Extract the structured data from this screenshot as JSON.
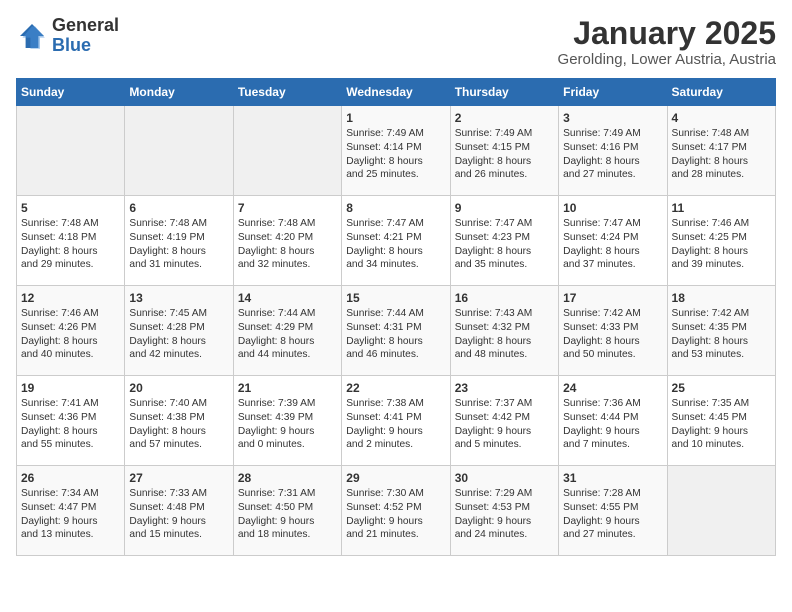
{
  "logo": {
    "general": "General",
    "blue": "Blue"
  },
  "title": "January 2025",
  "subtitle": "Gerolding, Lower Austria, Austria",
  "weekdays": [
    "Sunday",
    "Monday",
    "Tuesday",
    "Wednesday",
    "Thursday",
    "Friday",
    "Saturday"
  ],
  "weeks": [
    [
      {
        "empty": true
      },
      {
        "empty": true
      },
      {
        "empty": true
      },
      {
        "day": "1",
        "lines": [
          "Sunrise: 7:49 AM",
          "Sunset: 4:14 PM",
          "Daylight: 8 hours",
          "and 25 minutes."
        ]
      },
      {
        "day": "2",
        "lines": [
          "Sunrise: 7:49 AM",
          "Sunset: 4:15 PM",
          "Daylight: 8 hours",
          "and 26 minutes."
        ]
      },
      {
        "day": "3",
        "lines": [
          "Sunrise: 7:49 AM",
          "Sunset: 4:16 PM",
          "Daylight: 8 hours",
          "and 27 minutes."
        ]
      },
      {
        "day": "4",
        "lines": [
          "Sunrise: 7:48 AM",
          "Sunset: 4:17 PM",
          "Daylight: 8 hours",
          "and 28 minutes."
        ]
      }
    ],
    [
      {
        "day": "5",
        "lines": [
          "Sunrise: 7:48 AM",
          "Sunset: 4:18 PM",
          "Daylight: 8 hours",
          "and 29 minutes."
        ]
      },
      {
        "day": "6",
        "lines": [
          "Sunrise: 7:48 AM",
          "Sunset: 4:19 PM",
          "Daylight: 8 hours",
          "and 31 minutes."
        ]
      },
      {
        "day": "7",
        "lines": [
          "Sunrise: 7:48 AM",
          "Sunset: 4:20 PM",
          "Daylight: 8 hours",
          "and 32 minutes."
        ]
      },
      {
        "day": "8",
        "lines": [
          "Sunrise: 7:47 AM",
          "Sunset: 4:21 PM",
          "Daylight: 8 hours",
          "and 34 minutes."
        ]
      },
      {
        "day": "9",
        "lines": [
          "Sunrise: 7:47 AM",
          "Sunset: 4:23 PM",
          "Daylight: 8 hours",
          "and 35 minutes."
        ]
      },
      {
        "day": "10",
        "lines": [
          "Sunrise: 7:47 AM",
          "Sunset: 4:24 PM",
          "Daylight: 8 hours",
          "and 37 minutes."
        ]
      },
      {
        "day": "11",
        "lines": [
          "Sunrise: 7:46 AM",
          "Sunset: 4:25 PM",
          "Daylight: 8 hours",
          "and 39 minutes."
        ]
      }
    ],
    [
      {
        "day": "12",
        "lines": [
          "Sunrise: 7:46 AM",
          "Sunset: 4:26 PM",
          "Daylight: 8 hours",
          "and 40 minutes."
        ]
      },
      {
        "day": "13",
        "lines": [
          "Sunrise: 7:45 AM",
          "Sunset: 4:28 PM",
          "Daylight: 8 hours",
          "and 42 minutes."
        ]
      },
      {
        "day": "14",
        "lines": [
          "Sunrise: 7:44 AM",
          "Sunset: 4:29 PM",
          "Daylight: 8 hours",
          "and 44 minutes."
        ]
      },
      {
        "day": "15",
        "lines": [
          "Sunrise: 7:44 AM",
          "Sunset: 4:31 PM",
          "Daylight: 8 hours",
          "and 46 minutes."
        ]
      },
      {
        "day": "16",
        "lines": [
          "Sunrise: 7:43 AM",
          "Sunset: 4:32 PM",
          "Daylight: 8 hours",
          "and 48 minutes."
        ]
      },
      {
        "day": "17",
        "lines": [
          "Sunrise: 7:42 AM",
          "Sunset: 4:33 PM",
          "Daylight: 8 hours",
          "and 50 minutes."
        ]
      },
      {
        "day": "18",
        "lines": [
          "Sunrise: 7:42 AM",
          "Sunset: 4:35 PM",
          "Daylight: 8 hours",
          "and 53 minutes."
        ]
      }
    ],
    [
      {
        "day": "19",
        "lines": [
          "Sunrise: 7:41 AM",
          "Sunset: 4:36 PM",
          "Daylight: 8 hours",
          "and 55 minutes."
        ]
      },
      {
        "day": "20",
        "lines": [
          "Sunrise: 7:40 AM",
          "Sunset: 4:38 PM",
          "Daylight: 8 hours",
          "and 57 minutes."
        ]
      },
      {
        "day": "21",
        "lines": [
          "Sunrise: 7:39 AM",
          "Sunset: 4:39 PM",
          "Daylight: 9 hours",
          "and 0 minutes."
        ]
      },
      {
        "day": "22",
        "lines": [
          "Sunrise: 7:38 AM",
          "Sunset: 4:41 PM",
          "Daylight: 9 hours",
          "and 2 minutes."
        ]
      },
      {
        "day": "23",
        "lines": [
          "Sunrise: 7:37 AM",
          "Sunset: 4:42 PM",
          "Daylight: 9 hours",
          "and 5 minutes."
        ]
      },
      {
        "day": "24",
        "lines": [
          "Sunrise: 7:36 AM",
          "Sunset: 4:44 PM",
          "Daylight: 9 hours",
          "and 7 minutes."
        ]
      },
      {
        "day": "25",
        "lines": [
          "Sunrise: 7:35 AM",
          "Sunset: 4:45 PM",
          "Daylight: 9 hours",
          "and 10 minutes."
        ]
      }
    ],
    [
      {
        "day": "26",
        "lines": [
          "Sunrise: 7:34 AM",
          "Sunset: 4:47 PM",
          "Daylight: 9 hours",
          "and 13 minutes."
        ]
      },
      {
        "day": "27",
        "lines": [
          "Sunrise: 7:33 AM",
          "Sunset: 4:48 PM",
          "Daylight: 9 hours",
          "and 15 minutes."
        ]
      },
      {
        "day": "28",
        "lines": [
          "Sunrise: 7:31 AM",
          "Sunset: 4:50 PM",
          "Daylight: 9 hours",
          "and 18 minutes."
        ]
      },
      {
        "day": "29",
        "lines": [
          "Sunrise: 7:30 AM",
          "Sunset: 4:52 PM",
          "Daylight: 9 hours",
          "and 21 minutes."
        ]
      },
      {
        "day": "30",
        "lines": [
          "Sunrise: 7:29 AM",
          "Sunset: 4:53 PM",
          "Daylight: 9 hours",
          "and 24 minutes."
        ]
      },
      {
        "day": "31",
        "lines": [
          "Sunrise: 7:28 AM",
          "Sunset: 4:55 PM",
          "Daylight: 9 hours",
          "and 27 minutes."
        ]
      },
      {
        "empty": true
      }
    ]
  ]
}
